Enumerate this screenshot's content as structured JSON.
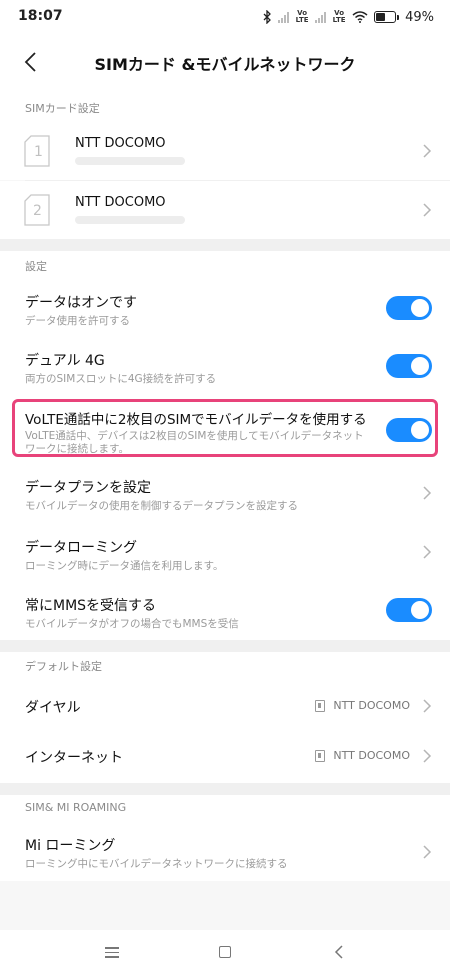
{
  "status": {
    "time": "18:07",
    "volte1": "Vo\nLTE",
    "volte2": "Vo\nLTE",
    "battery": "49%"
  },
  "header": {
    "title": "SIMカード &モバイルネットワーク"
  },
  "sim_section": {
    "label": "SIMカード設定",
    "cards": [
      {
        "slot": "1",
        "name": "NTT DOCOMO"
      },
      {
        "slot": "2",
        "name": "NTT DOCOMO"
      }
    ]
  },
  "settings_section": {
    "label": "設定",
    "items": [
      {
        "title": "データはオンです",
        "sub": "データ使用を許可する",
        "toggle": true
      },
      {
        "title": "デュアル 4G",
        "sub": "両方のSIMスロットに4G接続を許可する",
        "toggle": true
      },
      {
        "title": "VoLTE通話中に2枚目のSIMでモバイルデータを使用する",
        "sub1": "VoLTE通話中、デバイスは2枚目のSIMを使用してモバイルデータネット",
        "sub2": "ワークに接続します。",
        "toggle": true
      },
      {
        "title": "データプランを設定",
        "sub": "モバイルデータの使用を制御するデータプランを設定する"
      },
      {
        "title": "データローミング",
        "sub": "ローミング時にデータ通信を利用します。"
      },
      {
        "title": "常にMMSを受信する",
        "sub": "モバイルデータがオフの場合でもMMSを受信",
        "toggle": true
      }
    ]
  },
  "default_section": {
    "label": "デフォルト設定",
    "items": [
      {
        "title": "ダイヤル",
        "value": "NTT DOCOMO"
      },
      {
        "title": "インターネット",
        "value": "NTT DOCOMO"
      }
    ]
  },
  "roaming_section": {
    "label": "SIM& MI ROAMING",
    "items": [
      {
        "title": "Mi ローミング",
        "sub": "ローミング中にモバイルデータネットワークに接続する"
      }
    ]
  },
  "colors": {
    "accent": "#1a8cff",
    "highlight": "#e8437a"
  }
}
